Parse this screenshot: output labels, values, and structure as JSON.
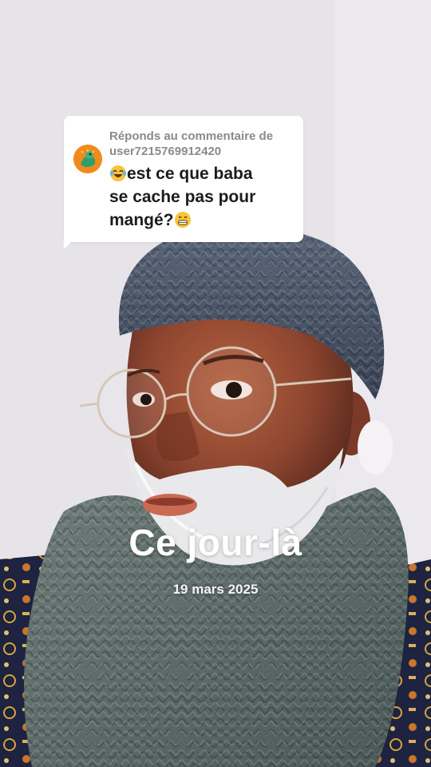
{
  "reply_sticker": {
    "heading_prefix": "Réponds au commentaire de",
    "username": "user7215769912420",
    "comment_line1": "est ce que baba",
    "comment_line2": "se cache pas pour",
    "comment_line3": "mangé?",
    "emoji_start": "laughing-tears-emoji",
    "emoji_end": "grinning-emoji"
  },
  "overlay": {
    "title": "Ce jour-là",
    "date": "19 mars 2025"
  },
  "colors": {
    "background_wall": "#e6e3e8",
    "hat": "#4d5a6e",
    "scarf": "#5f6f6c",
    "beard": "#e8e8ea",
    "skin": "#9a4f37",
    "sticker_avatar": "#f08a1c",
    "caption_text": "#ffffff"
  }
}
